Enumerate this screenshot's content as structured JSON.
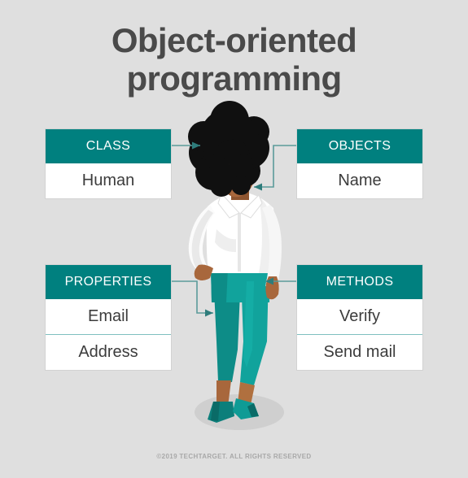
{
  "title": {
    "line1": "Object-oriented",
    "line2": "programming"
  },
  "colors": {
    "background": "#dfdfdf",
    "accent_teal": "#00807f",
    "header_text": "#ffffff",
    "body_text": "#3c3c3c",
    "title_text": "#4a4a4a",
    "divider": "#7fc0bf",
    "footer_text": "#a8a8a8",
    "skin": "#a8673c",
    "hair": "#101010",
    "blouse": "#ffffff",
    "trousers": "#0f9b95",
    "shoes": "#0c7f7b",
    "shadow": "#cfcfcf"
  },
  "boxes": [
    {
      "id": "class",
      "header": "CLASS",
      "rows": [
        "Human"
      ]
    },
    {
      "id": "objects",
      "header": "OBJECTS",
      "rows": [
        "Name"
      ]
    },
    {
      "id": "properties",
      "header": "PROPERTIES",
      "rows": [
        "Email",
        "Address"
      ]
    },
    {
      "id": "methods",
      "header": "METHODS",
      "rows": [
        "Verify",
        "Send mail"
      ]
    }
  ],
  "illustration": {
    "subject": "standing-woman-illustration",
    "description": "Woman with afro hair, white blouse, teal trousers and teal high heels"
  },
  "footer": {
    "copyright": "©2019 TECHTARGET. ALL RIGHTS RESERVED"
  }
}
